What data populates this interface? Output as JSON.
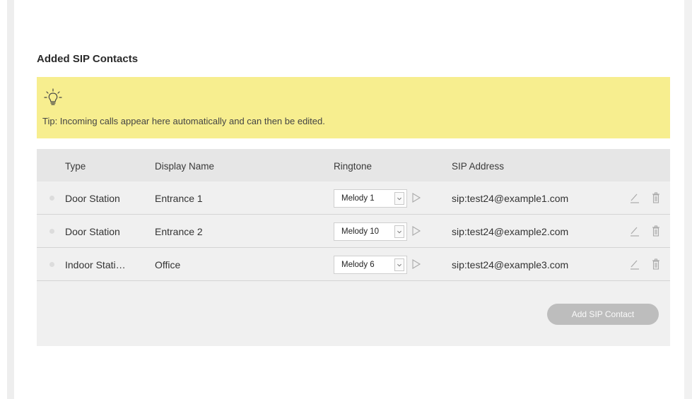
{
  "section": {
    "title": "Added SIP Contacts"
  },
  "tip": {
    "text": "Tip: Incoming calls appear here automatically and can then be edited.",
    "icon": "lightbulb-icon"
  },
  "table": {
    "headers": {
      "type": "Type",
      "display_name": "Display Name",
      "ringtone": "Ringtone",
      "sip_address": "SIP Address"
    },
    "rows": [
      {
        "type": "Door Station",
        "display_name": "Entrance 1",
        "ringtone": "Melody 1",
        "sip_address": "sip:test24@example1.com"
      },
      {
        "type": "Door Station",
        "display_name": "Entrance 2",
        "ringtone": "Melody 10",
        "sip_address": "sip:test24@example2.com"
      },
      {
        "type": "Indoor Stati…",
        "display_name": "Office",
        "ringtone": "Melody 6",
        "sip_address": "sip:test24@example3.com"
      }
    ]
  },
  "actions": {
    "add_label": "Add SIP Contact"
  },
  "colors": {
    "tip_background": "#f7ee8f",
    "table_background": "#f0f0f0",
    "header_background": "#e6e6e6",
    "button_background": "#bdbdbd"
  }
}
